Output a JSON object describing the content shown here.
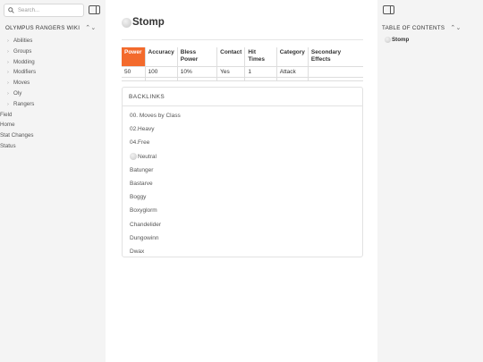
{
  "left_sidebar": {
    "search_placeholder": "Search...",
    "wiki_title": "OLYMPUS RANGERS WIKI",
    "nav_items": [
      {
        "label": "Abilities",
        "folder": true
      },
      {
        "label": "Groups",
        "folder": true
      },
      {
        "label": "Modding",
        "folder": true
      },
      {
        "label": "Modifiers",
        "folder": true
      },
      {
        "label": "Moves",
        "folder": true
      },
      {
        "label": "Oly",
        "folder": true
      },
      {
        "label": "Rangers",
        "folder": true
      },
      {
        "label": "Field",
        "folder": false
      },
      {
        "label": "Home",
        "folder": false
      },
      {
        "label": "Stat Changes",
        "folder": false
      },
      {
        "label": "Status",
        "folder": false
      }
    ]
  },
  "main": {
    "title": "Stomp",
    "table": {
      "headers": [
        "Power",
        "Accuracy",
        "Bless Power",
        "Contact",
        "Hit Times",
        "Category",
        "Secondary Effects"
      ],
      "row": [
        "50",
        "100",
        "10%",
        "Yes",
        "1",
        "Attack",
        ""
      ]
    },
    "backlinks": {
      "heading": "BACKLINKS",
      "items": [
        "00. Moves by Class",
        "02.Heavy",
        "04.Free",
        "Neutral",
        "Batunger",
        "Bastarve",
        "Boggy",
        "Boxyglorm",
        "Chandelider",
        "Dungowinn",
        "Dwax"
      ]
    }
  },
  "right_sidebar": {
    "toc_title": "TABLE OF CONTENTS",
    "toc_items": [
      "Stomp"
    ]
  },
  "colors": {
    "accent": "#f36a2c"
  }
}
